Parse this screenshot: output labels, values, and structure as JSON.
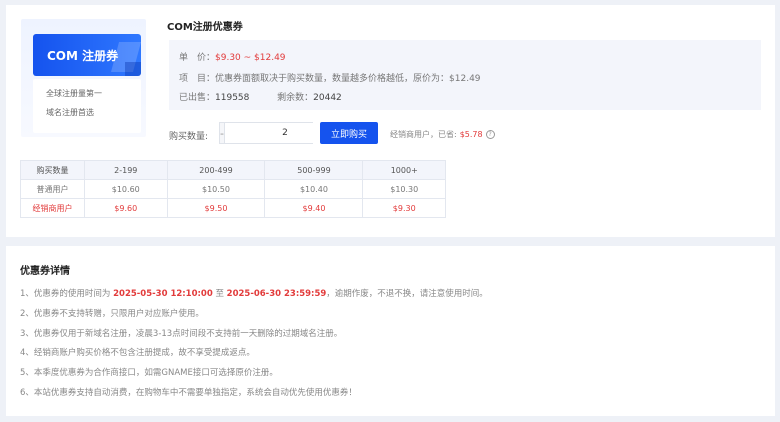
{
  "product": {
    "image": {
      "banner_text": "COM 注册券",
      "line1": "全球注册量第一",
      "line2": "域名注册首选"
    },
    "title": "COM注册优惠券",
    "price_label": "单　价：",
    "price_value": "$9.30 ~ $12.49",
    "item_label": "项　目：",
    "item_text": "优惠券面额取决于购买数量，数量越多价格越低，原价为：",
    "original_price": "$12.49",
    "sold_label": "已出售：",
    "sold_value": "119558",
    "remaining_label": "剩余数：",
    "remaining_value": "20442"
  },
  "purchase": {
    "qty_label": "购买数量:",
    "minus": "-",
    "plus": "+",
    "qty_value": "2",
    "buy_label": "立即购买",
    "saving_label": "经销商用户，已省:",
    "saving_value": "$5.78",
    "help_symbol": "?"
  },
  "price_table": {
    "headers": [
      "购买数量",
      "2-199",
      "200-499",
      "500-999",
      "1000+"
    ],
    "rows": [
      {
        "name": "普通用户",
        "prices": [
          "$10.60",
          "$10.50",
          "$10.40",
          "$10.30"
        ]
      },
      {
        "name": "经销商用户",
        "prices": [
          "$9.60",
          "$9.50",
          "$9.40",
          "$9.30"
        ]
      }
    ]
  },
  "details": {
    "title": "优惠券详情",
    "item1_prefix": "1、优惠券的使用时间为",
    "item1_start": "2025-05-30 12:10:00",
    "item1_mid": "至",
    "item1_end": "2025-06-30 23:59:59",
    "item1_suffix": "，逾期作废，不退不换，请注意使用时间。",
    "items": [
      "2、优惠券不支持转赠，只限用户对应账户使用。",
      "3、优惠券仅用于新域名注册，凌晨3-13点时间段不支持前一天删除的过期域名注册。",
      "4、经销商账户购买价格不包含注册提成，故不享受提成返点。",
      "5、本季度优惠券为合作商接口，如需GNAME接口可选择原价注册。",
      "6、本站优惠券支持自动消费，在购物车中不需要单独指定，系统会自动优先使用优惠券！"
    ]
  },
  "colors": {
    "accent": "#1553ee",
    "price_red": "#e23b3b",
    "page_bg": "#eef1f7",
    "info_bg": "#f3f5fb"
  }
}
